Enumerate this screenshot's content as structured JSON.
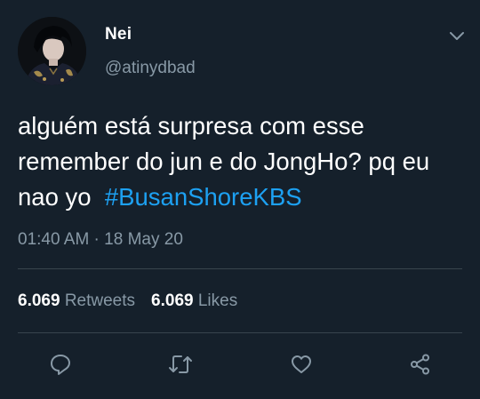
{
  "tweet": {
    "author": {
      "name": "Nei",
      "handle": "@atinydbad"
    },
    "text": "alguém está surpresa com esse remember do jun e do JongHo? pq eu nao yo  ",
    "hashtag": "#BusanShoreKBS",
    "timestamp": "01:40 AM · 18 May 20",
    "stats": {
      "retweets_count": "6.069",
      "retweets_label": "Retweets",
      "likes_count": "6.069",
      "likes_label": "Likes"
    },
    "actions": [
      "reply-icon",
      "retweet-icon",
      "like-icon",
      "share-icon"
    ]
  },
  "colors": {
    "background": "#15202b",
    "text_primary": "#ffffff",
    "text_secondary": "#8899a6",
    "accent": "#1da1f2",
    "divider": "#38444d"
  }
}
